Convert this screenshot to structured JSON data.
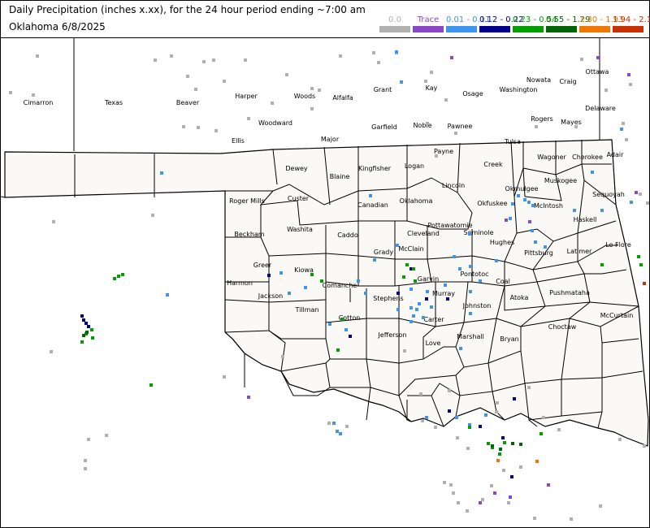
{
  "header": {
    "title": "Daily Precipitation (inches  x.xx),  for the 24 hour period ending ~7:00 am",
    "subtitle": "Oklahoma 6/8/2025"
  },
  "legend": [
    {
      "label": "0.0",
      "color": "#b0b0b0"
    },
    {
      "label": "Trace",
      "color": "#8c46c8"
    },
    {
      "label": "0.01 - 0.11",
      "color": "#3c96f0"
    },
    {
      "label": "0.12 - 0.22",
      "color": "#00008c"
    },
    {
      "label": "0.23 - 0.54",
      "color": "#00a000"
    },
    {
      "label": "0.55 - 1.29",
      "color": "#006400"
    },
    {
      "label": "1.30 - 1.93",
      "color": "#f07800"
    },
    {
      "label": "1.94 - 2.14",
      "color": "#c83200"
    }
  ],
  "counties": [
    "Cimarron",
    "Texas",
    "Beaver",
    "Harper",
    "Woods",
    "Alfalfa",
    "Grant",
    "Kay",
    "Osage",
    "Washington",
    "Nowata",
    "Craig",
    "Ottawa",
    "Woodward",
    "Major",
    "Garfield",
    "Noble",
    "Pawnee",
    "Rogers",
    "Mayes",
    "Delaware",
    "Ellis",
    "Tulsa",
    "Wagoner",
    "Cherokee",
    "Adair",
    "Dewey",
    "Blaine",
    "Kingfisher",
    "Logan",
    "Payne",
    "Creek",
    "Okmulgee",
    "Muskogee",
    "Sequoyah",
    "Roger Mills",
    "Custer",
    "Canadian",
    "Oklahoma",
    "Lincoln",
    "Okfuskee",
    "McIntosh",
    "Haskell",
    "Beckham",
    "Washita",
    "Caddo",
    "Cleveland",
    "Pottawatomie",
    "Seminole",
    "Hughes",
    "Pittsburg",
    "Latimer",
    "Le Flore",
    "Greer",
    "Harmon",
    "Kiowa",
    "Grady",
    "McClain",
    "Garvin",
    "Pontotoc",
    "Coal",
    "Jackson",
    "Comanche",
    "Stephens",
    "Murray",
    "Johnston",
    "Atoka",
    "Pushmataha",
    "Tillman",
    "Cotton",
    "Carter",
    "Jefferson",
    "Love",
    "Marshall",
    "Bryan",
    "Choctaw",
    "McCurtain"
  ],
  "stations_by_category": {
    "0.0": [
      [
        45,
        68
      ],
      [
        190,
        73
      ],
      [
        210,
        68
      ],
      [
        230,
        93
      ],
      [
        240,
        109
      ],
      [
        250,
        75
      ],
      [
        262,
        73
      ],
      [
        275,
        99
      ],
      [
        301,
        73
      ],
      [
        352,
        91
      ],
      [
        383,
        108
      ],
      [
        418,
        68
      ],
      [
        459,
        64
      ],
      [
        487,
        64
      ],
      [
        530,
        88
      ],
      [
        548,
        122
      ],
      [
        465,
        76
      ],
      [
        493,
        100
      ],
      [
        523,
        99
      ],
      [
        525,
        151
      ],
      [
        536,
        191
      ],
      [
        560,
        163
      ],
      [
        659,
        155
      ],
      [
        708,
        155
      ],
      [
        775,
        103
      ],
      [
        715,
        72
      ],
      [
        745,
        110
      ],
      [
        766,
        151
      ],
      [
        770,
        171
      ],
      [
        787,
        238
      ],
      [
        796,
        249
      ],
      [
        187,
        264
      ],
      [
        65,
        272
      ],
      [
        12,
        113
      ],
      [
        40,
        116
      ],
      [
        225,
        155
      ],
      [
        243,
        156
      ],
      [
        265,
        160
      ],
      [
        305,
        145
      ],
      [
        334,
        126
      ],
      [
        383,
        133
      ],
      [
        392,
        110
      ],
      [
        347,
        438
      ],
      [
        275,
        463
      ],
      [
        108,
        540
      ],
      [
        104,
        566
      ],
      [
        104,
        576
      ],
      [
        130,
        535
      ],
      [
        62,
        432
      ],
      [
        426,
        524
      ],
      [
        404,
        520
      ],
      [
        519,
        517
      ],
      [
        535,
        525
      ],
      [
        562,
        538
      ],
      [
        575,
        551
      ],
      [
        554,
        596
      ],
      [
        557,
        606
      ],
      [
        563,
        618
      ],
      [
        574,
        628
      ],
      [
        593,
        614
      ],
      [
        625,
        618
      ],
      [
        640,
        574
      ],
      [
        657,
        637
      ],
      [
        610,
        506
      ],
      [
        668,
        513
      ],
      [
        687,
        528
      ],
      [
        762,
        540
      ],
      [
        792,
        548
      ],
      [
        738,
        622
      ],
      [
        702,
        638
      ],
      [
        604,
        597
      ],
      [
        619,
        578
      ],
      [
        546,
        593
      ],
      [
        517,
        484
      ],
      [
        497,
        431
      ],
      [
        552,
        480
      ],
      [
        611,
        495
      ],
      [
        650,
        476
      ]
    ],
    "Trace": [
      [
        555,
        70
      ],
      [
        735,
        70
      ],
      [
        773,
        91
      ],
      [
        782,
        236
      ],
      [
        651,
        272
      ],
      [
        622,
        270
      ],
      [
        305,
        488
      ],
      [
        590,
        618
      ],
      [
        608,
        606
      ],
      [
        627,
        611
      ],
      [
        674,
        596
      ]
    ],
    "0.01 - 0.11": [
      [
        198,
        212
      ],
      [
        487,
        63
      ],
      [
        493,
        100
      ],
      [
        205,
        362
      ],
      [
        460,
        319
      ],
      [
        440,
        345
      ],
      [
        505,
        355
      ],
      [
        525,
        358
      ],
      [
        515,
        373
      ],
      [
        512,
        380
      ],
      [
        508,
        388
      ],
      [
        505,
        378
      ],
      [
        530,
        377
      ],
      [
        520,
        390
      ],
      [
        505,
        395
      ],
      [
        547,
        350
      ],
      [
        578,
        385
      ],
      [
        578,
        358
      ],
      [
        578,
        327
      ],
      [
        590,
        345
      ],
      [
        577,
        287
      ],
      [
        630,
        250
      ],
      [
        637,
        240
      ],
      [
        645,
        245
      ],
      [
        650,
        248
      ],
      [
        655,
        252
      ],
      [
        627,
        268
      ],
      [
        654,
        283
      ],
      [
        610,
        320
      ],
      [
        455,
        240
      ],
      [
        488,
        301
      ],
      [
        558,
        315
      ],
      [
        565,
        330
      ],
      [
        489,
        380
      ],
      [
        449,
        360
      ],
      [
        410,
        520
      ],
      [
        414,
        530
      ],
      [
        418,
        533
      ],
      [
        566,
        428
      ],
      [
        577,
        522
      ],
      [
        597,
        510
      ],
      [
        561,
        513
      ],
      [
        524,
        513
      ],
      [
        764,
        158
      ],
      [
        728,
        211
      ],
      [
        658,
        297
      ],
      [
        670,
        303
      ],
      [
        706,
        258
      ],
      [
        740,
        258
      ],
      [
        776,
        248
      ],
      [
        425,
        405
      ],
      [
        405,
        398
      ],
      [
        375,
        353
      ],
      [
        355,
        360
      ],
      [
        345,
        335
      ]
    ],
    "0.12 - 0.22": [
      [
        330,
        338
      ],
      [
        100,
        388
      ],
      [
        102,
        393
      ],
      [
        105,
        397
      ],
      [
        108,
        401
      ],
      [
        489,
        360
      ],
      [
        505,
        330
      ],
      [
        524,
        367
      ],
      [
        550,
        367
      ],
      [
        430,
        413
      ],
      [
        632,
        490
      ],
      [
        618,
        538
      ],
      [
        629,
        586
      ],
      [
        590,
        524
      ],
      [
        552,
        505
      ]
    ],
    "0.23 - 0.54": [
      [
        140,
        342
      ],
      [
        145,
        339
      ],
      [
        150,
        337
      ],
      [
        100,
        420
      ],
      [
        105,
        410
      ],
      [
        112,
        405
      ],
      [
        113,
        415
      ],
      [
        500,
        325
      ],
      [
        508,
        330
      ],
      [
        496,
        340
      ],
      [
        510,
        345
      ],
      [
        395,
        345
      ],
      [
        383,
        337
      ],
      [
        415,
        430
      ],
      [
        420,
        392
      ],
      [
        600,
        545
      ],
      [
        605,
        550
      ],
      [
        614,
        558
      ],
      [
        620,
        544
      ],
      [
        740,
        325
      ],
      [
        785,
        315
      ],
      [
        788,
        325
      ],
      [
        577,
        525
      ],
      [
        185,
        473
      ],
      [
        665,
        533
      ]
    ],
    "0.55 - 1.29": [
      [
        102,
        412
      ],
      [
        106,
        408
      ],
      [
        605,
        548
      ],
      [
        615,
        552
      ],
      [
        630,
        545
      ],
      [
        640,
        546
      ]
    ],
    "1.30 - 1.93": [
      [
        612,
        566
      ],
      [
        660,
        567
      ]
    ],
    "1.94 - 2.14": [
      [
        792,
        348
      ]
    ]
  }
}
